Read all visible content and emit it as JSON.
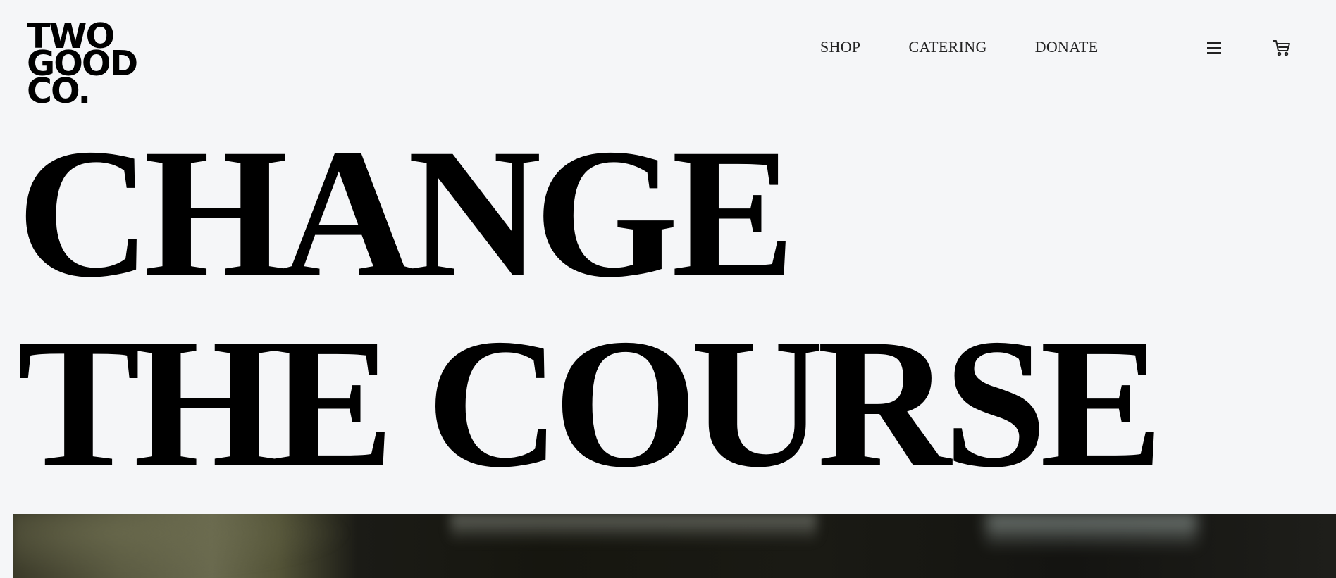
{
  "logo": {
    "lines": [
      "TWO",
      "GOOD",
      "CO."
    ]
  },
  "nav": {
    "items": [
      {
        "label": "SHOP"
      },
      {
        "label": "CATERING"
      },
      {
        "label": "DONATE"
      }
    ]
  },
  "icons": {
    "menu": "hamburger-menu-icon",
    "cart": "shopping-cart-icon"
  },
  "hero": {
    "headline_lines": [
      "CHANGE",
      "THE COURSE"
    ]
  },
  "colors": {
    "background": "#f5f6f8",
    "text": "#000000"
  }
}
